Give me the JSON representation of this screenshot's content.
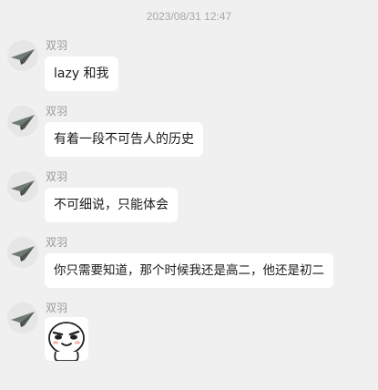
{
  "chat": {
    "timestamp": "2023/08/31 12:47",
    "sender": "双羽",
    "messages": [
      {
        "text": "lazy 和我"
      },
      {
        "text": "有着一段不可告人的历史"
      },
      {
        "text": "不可细说，只能体会"
      },
      {
        "text": "你只需要知道，那个时候我还是高二，他还是初二"
      },
      {
        "sticker": "smirking-face-sticker"
      }
    ]
  },
  "icons": {
    "avatar": "paper-plane-icon"
  },
  "colors": {
    "background": "#f0f0f0",
    "bubble": "#ffffff",
    "timestamp": "#a8a8a8",
    "sender": "#999999"
  }
}
